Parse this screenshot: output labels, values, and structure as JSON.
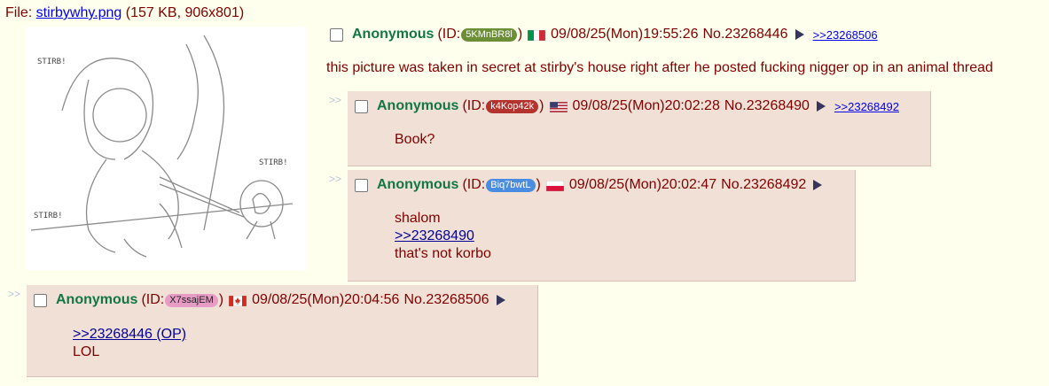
{
  "file": {
    "prefix": "File: ",
    "filename": "stirbywhy.png",
    "meta": " (157 KB, 906x801)"
  },
  "thumbnail": {
    "labels": [
      "STIRB!",
      "STIRB!",
      "STIRB!"
    ]
  },
  "op": {
    "name": "Anonymous",
    "id_prefix": "(ID: ",
    "id": "5KMnBR8l",
    "id_color": "#6C8E34",
    "id_suffix": ")",
    "flag": "italy",
    "datetime": "09/08/25(Mon)19:55:26",
    "postnum": "No.23268446",
    "backlink": ">>23268506",
    "message": "this picture was taken in secret at stirby's house right after he posted fucking nigger op in an animal thread"
  },
  "replies": [
    {
      "side": ">>",
      "name": "Anonymous",
      "id_prefix": "(ID: ",
      "id": "k4Kop42k",
      "id_color": "#B5332F",
      "id_suffix": ")",
      "flag": "usa",
      "datetime": "09/08/25(Mon)20:02:28",
      "postnum": "No.23268490",
      "backlink": ">>23268492",
      "lines": [
        "Book?"
      ]
    },
    {
      "side": ">>",
      "name": "Anonymous",
      "id_prefix": "(ID: ",
      "id": "Biq7bwtL",
      "id_color": "#4A8DE0",
      "id_suffix": ")",
      "flag": "poland",
      "datetime": "09/08/25(Mon)20:02:47",
      "postnum": "No.23268492",
      "quote": ">>23268490",
      "lines": [
        "shalom",
        "that's not korbo"
      ]
    },
    {
      "side": ">>",
      "name": "Anonymous",
      "id_prefix": "(ID: ",
      "id": "X7ssajEM",
      "id_color": "#E79CC6",
      "id_suffix": ")",
      "flag": "canada",
      "datetime": "09/08/25(Mon)20:04:56",
      "postnum": "No.23268506",
      "quote": ">>23268446 (OP)",
      "lines": [
        "LOL"
      ]
    }
  ]
}
